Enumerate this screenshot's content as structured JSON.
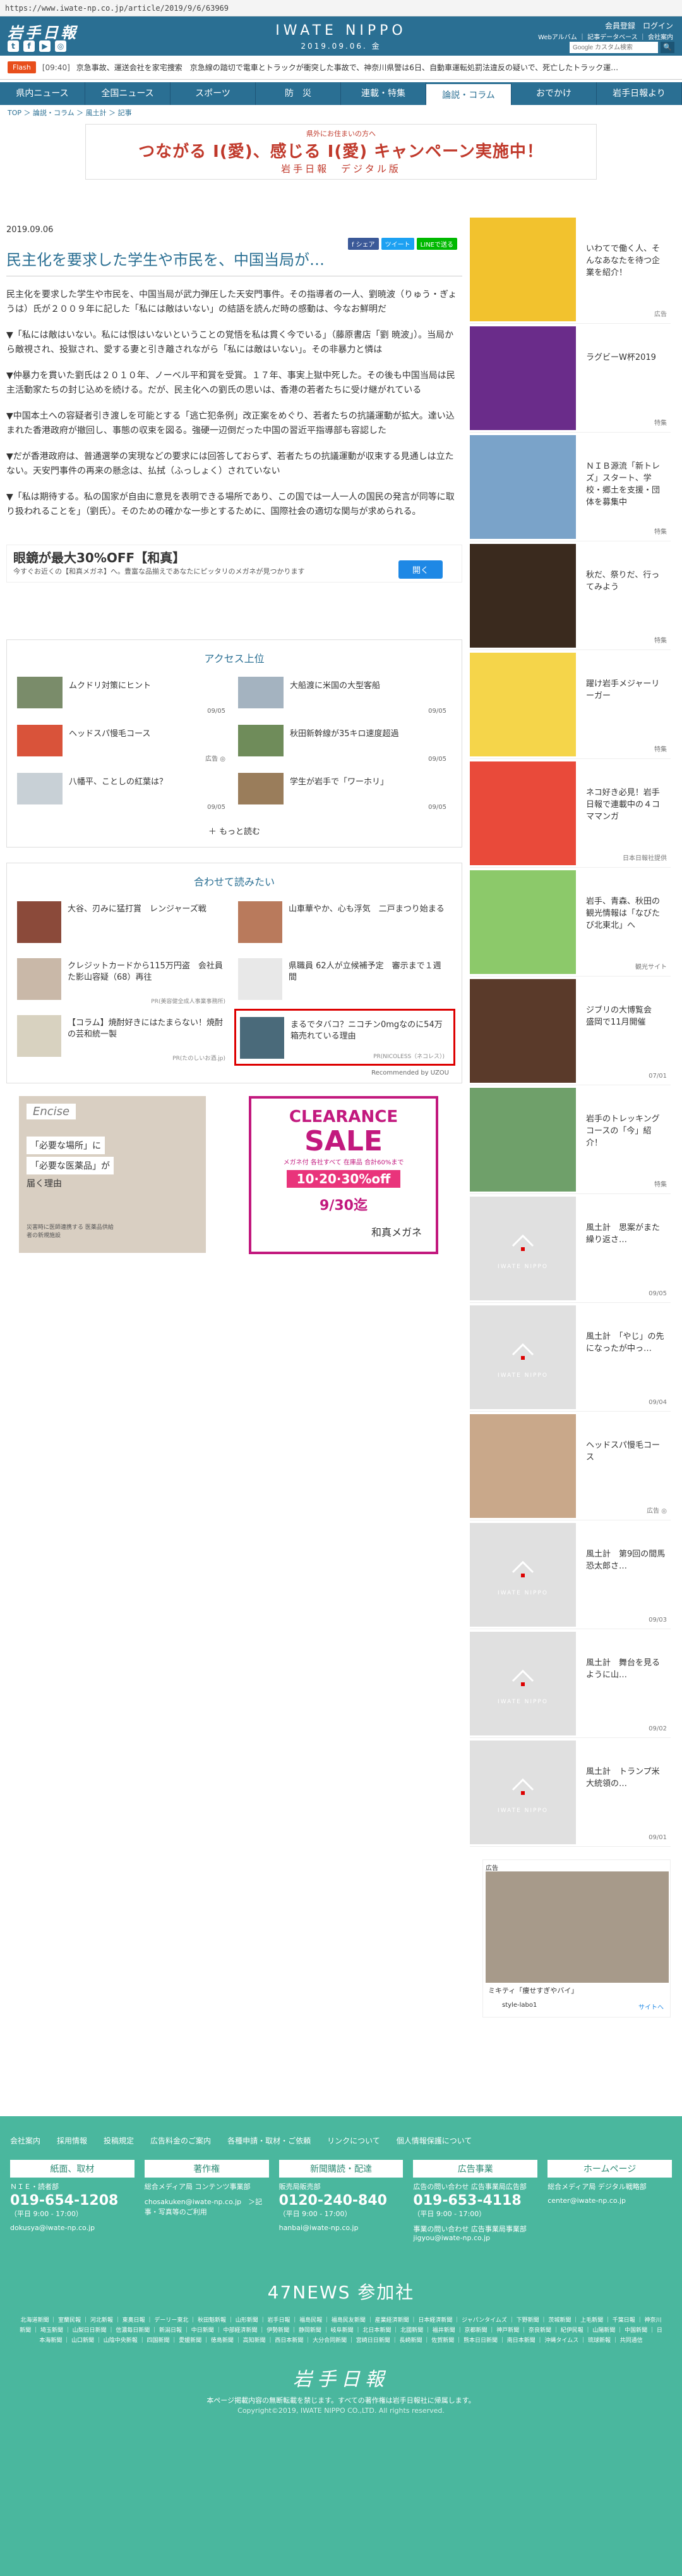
{
  "browser": {
    "url": "https://www.iwate-np.co.jp/article/2019/9/6/63969"
  },
  "header": {
    "logo": "岩手日報",
    "brand": "IWATE NIPPO",
    "date": "2019.09.06. 金",
    "login": "会員登録　ログイン",
    "links": "Webアルバム ｜ 記事データベース ｜ 会社案内",
    "search_placeholder": "Google カスタム検索",
    "search_button": "🔍",
    "socials": [
      "t",
      "f",
      "▶",
      "◎"
    ]
  },
  "flash": {
    "tag": "Flash",
    "time": "[09:40]",
    "text": "京急事故、運送会社を家宅捜索　京急線の踏切で電車とトラックが衝突した事故で、神奈川県警は6日、自動車運転処罰法違反の疑いで、死亡したトラック運…"
  },
  "nav": [
    "県内ニュース",
    "全国ニュース",
    "スポーツ",
    "防　災",
    "連載・特集",
    "論説・コラム",
    "おでかけ",
    "岩手日報より"
  ],
  "breadcrumb": "TOP ＞ 論説・コラム ＞ 風土計 ＞ 記事",
  "banner": {
    "sub": "県外にお住まいの方へ",
    "main": "つながる I(愛)、感じる I(愛) キャンペーン実施中！",
    "foot": "岩手日報　デジタル版"
  },
  "article": {
    "date": "2019.09.06",
    "share": [
      "f シェア",
      "ツイート",
      "LINEで送る"
    ],
    "title": "民主化を要求した学生や市民を、中国当局が…",
    "paragraphs": [
      "民主化を要求した学生や市民を、中国当局が武力弾圧した天安門事件。その指導者の一人、劉暁波（りゅう・ぎょうは）氏が２００９年に記した「私には敵はいない」の結語を読んだ時の感動は、今なお鮮明だ",
      "▼「私には敵はいない。私には恨はいないということの覚悟を私は貫く今でいる」（藤原書店「劉 暁波」）。当局から敵視され、投獄され、愛する妻と引き離されながら「私には敵はいない」。その非暴力と憐は",
      "▼仲暴力を貫いた劉氏は２０１０年、ノーベル平和賞を受賞。１７年、事実上獄中死した。その後も中国当局は民主活動家たちの封じ込めを続ける。だが、民主化への劉氏の思いは、香港の若者たちに受け継がれている",
      "▼中国本土への容疑者引き渡しを可能とする「逃亡犯条例」改正案をめぐり、若者たちの抗議運動が拡大。達い込まれた香港政府が撤回し、事態の収束を図る。強硬一辺倒だった中国の習近平指導部も容認した",
      "▼だが香港政府は、普通選挙の実現などの要求には回答しておらず、若者たちの抗議運動が収束する見通しは立たない。天安門事件の再来の懸念は、払拭（ふっしょく）されていない",
      "▼「私は期待する。私の国家が自由に意見を表明できる場所であり、この国では一人一人の国民の発言が同等に取り扱われることを」（劉氏）。そのための確かな一歩とするために、国際社会の適切な関与が求められる。"
    ]
  },
  "ad1": {
    "title": "眼鏡が最大30%OFF【和真】",
    "desc": "今すぐお近くの【和真メガネ】へ。豊富な品揃えであなたにピッタリのメガネが見つかります",
    "button": "開く"
  },
  "access": {
    "heading": "アクセス上位",
    "items": [
      {
        "text": "ムクドリ対策にヒント",
        "date": "09/05"
      },
      {
        "text": "大船渡に米国の大型客船",
        "date": "09/05"
      },
      {
        "text": "ヘッドスパ慢毛コース",
        "date": "広告 ◎"
      },
      {
        "text": "秋田新幹線が35キロ速度超過",
        "date": "09/05"
      },
      {
        "text": "八幡平、ことしの紅葉は？",
        "date": "09/05"
      },
      {
        "text": "学生が岩手で「ワーホリ」",
        "date": "09/05"
      }
    ],
    "more": "＋ もっと読む"
  },
  "related": {
    "heading": "合わせて読みたい",
    "items": [
      {
        "text": "大谷、刃みに猛打賞　レンジャーズ戦",
        "pr": ""
      },
      {
        "text": "山車華やか、心も浮気　二戸まつり始まる",
        "pr": ""
      },
      {
        "text": "クレジットカードから115万円盗　会社員た影山容疑（68）再往",
        "pr": "PR(美容健全成人事業事務所)"
      },
      {
        "text": "県職員 62人が立候補予定　審示まで１週間",
        "pr": ""
      },
      {
        "text": "【コラム】焼酎好きにはたまらない！焼酎の芸和統一製",
        "pr": "PR(たのしいお酒.jp)"
      },
      {
        "text": "まるでタバコ？ニコチン0mgなのに54万箱売れている理由",
        "pr": "PR(NICOLESS（ネコレス）)"
      }
    ],
    "uzou": "Recommended by UZOU"
  },
  "ad2": {
    "logo": "Encise",
    "c1": "「必要な場所」に",
    "c2": "「必要な医薬品」が",
    "c3": "届く理由",
    "note": "災害時に医師連携する 医薬品供給者の新規施設",
    "sale_a": "CLEARANCE",
    "sale_b": "SALE",
    "sale_c": "メガネ付 各社すべて 在庫品 合計60%まで",
    "sale_d": "10·20·30%off",
    "sale_e": "9/30迄",
    "sale_f": "和真メガネ"
  },
  "sidebar": [
    {
      "text": "いわてで働く人、そんなあなたを待つ企業を紹介！",
      "meta": "広告"
    },
    {
      "text": "ラグビーW杯2019",
      "meta": "特集"
    },
    {
      "text": "ＮＩＢ源流「新トレズ」スタート、学校・郷土を支援・団体を募集中",
      "meta": "特集"
    },
    {
      "text": "秋だ、祭りだ、行ってみよう",
      "meta": "特集"
    },
    {
      "text": "躍け岩手メジャーリーガー",
      "meta": "特集"
    },
    {
      "text": "ネコ好き必見！岩手日報で連載中の４コママンガ",
      "meta": "日本日報社提供"
    },
    {
      "text": "岩手、青森、秋田の観光情報は「なびたび北東北」へ",
      "meta": "観光サイト"
    },
    {
      "text": "ジブリの大博覧会　盛岡で11月開催",
      "meta": "07/01"
    },
    {
      "text": "岩手のトレッキングコースの「今」紹介！",
      "meta": "特集"
    },
    {
      "text": "風土計　思案がまた繰り返さ…",
      "meta": "09/05"
    },
    {
      "text": "風土計　「やじ」の先になったが中っ…",
      "meta": "09/04"
    },
    {
      "text": "ヘッドスパ慢毛コース",
      "meta": "広告 ◎"
    },
    {
      "text": "風土計　第9回の間馬恐太郎さ…",
      "meta": "09/03"
    },
    {
      "text": "風土計　舞台を見るように山…",
      "meta": "09/02"
    },
    {
      "text": "風土計　トランプ米大統領の…",
      "meta": "09/01"
    }
  ],
  "sidebar_ad": {
    "label": "広告",
    "title": "ミキティ「痩せすぎやバイ」",
    "source": "style-labo1",
    "link": "サイトへ"
  },
  "footer": {
    "links": [
      "会社案内",
      "採用情報",
      "投稿規定",
      "広告料金のご案内",
      "各種申請・取材・ご依頼",
      "リンクについて",
      "個人情報保護について"
    ],
    "cols": [
      {
        "h": "紙面、取材",
        "l": "ＮＩＥ・読者部",
        "p": "019-654-1208",
        "q": "（平日 9:00 - 17:00）",
        "m": "dokusya@iwate-np.co.jp"
      },
      {
        "h": "著作権",
        "l": "総合メディア局 コンテンツ事業部",
        "p": "",
        "q": "",
        "m": "chosakuken@iwate-np.co.jp　＞記事・写真等のご利用"
      },
      {
        "h": "新聞購読・配達",
        "l": "販売局販売部",
        "p": "0120-240-840",
        "q": "（平日 9:00 - 17:00）",
        "m": "hanbai@iwate-np.co.jp"
      },
      {
        "h": "広告事業",
        "l": "広告の問い合わせ 広告事業局広告部",
        "p": "019-653-4118",
        "q": "（平日 9:00 - 17:00）",
        "m": "事業の問い合わせ 広告事業局事業部 jigyou@iwate-np.co.jp"
      },
      {
        "h": "ホームページ",
        "l": "総合メディア局 デジタル戦略部",
        "p": "",
        "q": "",
        "m": "center@iwate-np.co.jp"
      }
    ],
    "fortyseven": "47NEWS 参加社",
    "papers": "北海道新聞 ｜ 室蘭民報 ｜ 河北新報 ｜ 東奥日報 ｜ デーリー東北 ｜ 秋田魁新報 ｜ 山形新聞 ｜ 岩手日報 ｜ 福島民報 ｜ 福島民友新聞 ｜ 産業経済新聞 ｜ 日本経済新聞 ｜ ジャパンタイムズ ｜ 下野新聞 ｜ 茨城新聞 ｜ 上毛新聞 ｜ 千葉日報 ｜ 神奈川新聞 ｜ 埼玉新聞 ｜ 山梨日日新聞 ｜ 信濃毎日新聞 ｜ 新潟日報 ｜ 中日新聞 ｜ 中部経済新聞 ｜ 伊勢新聞 ｜ 静岡新聞 ｜ 岐阜新聞 ｜ 北日本新聞 ｜ 北國新聞 ｜ 福井新聞 ｜ 京都新聞 ｜ 神戸新聞 ｜ 奈良新聞 ｜ 紀伊民報 ｜ 山陽新聞 ｜ 中国新聞 ｜ 日本海新聞 ｜ 山口新聞 ｜ 山陰中央新報 ｜ 四国新聞 ｜ 愛媛新聞 ｜ 徳島新聞 ｜ 高知新聞 ｜ 西日本新聞 ｜ 大分合同新聞 ｜ 宮崎日日新聞 ｜ 長崎新聞 ｜ 佐賀新聞 ｜ 熊本日日新聞 ｜ 南日本新聞 ｜ 沖縄タイムス ｜ 琉球新報 ｜ 共同通信",
    "logo": "岩手日報",
    "copy": "本ページ掲載内容の無断転載を禁じます。すべての著作権は岩手日報社に帰属します。",
    "copy2": "Copyright©2019, IWATE NIPPO CO.,LTD. All rights reserved."
  },
  "colors": {
    "brand": "#2a6f93",
    "footer": "#4ab79e",
    "flash": "#e84e1b"
  }
}
